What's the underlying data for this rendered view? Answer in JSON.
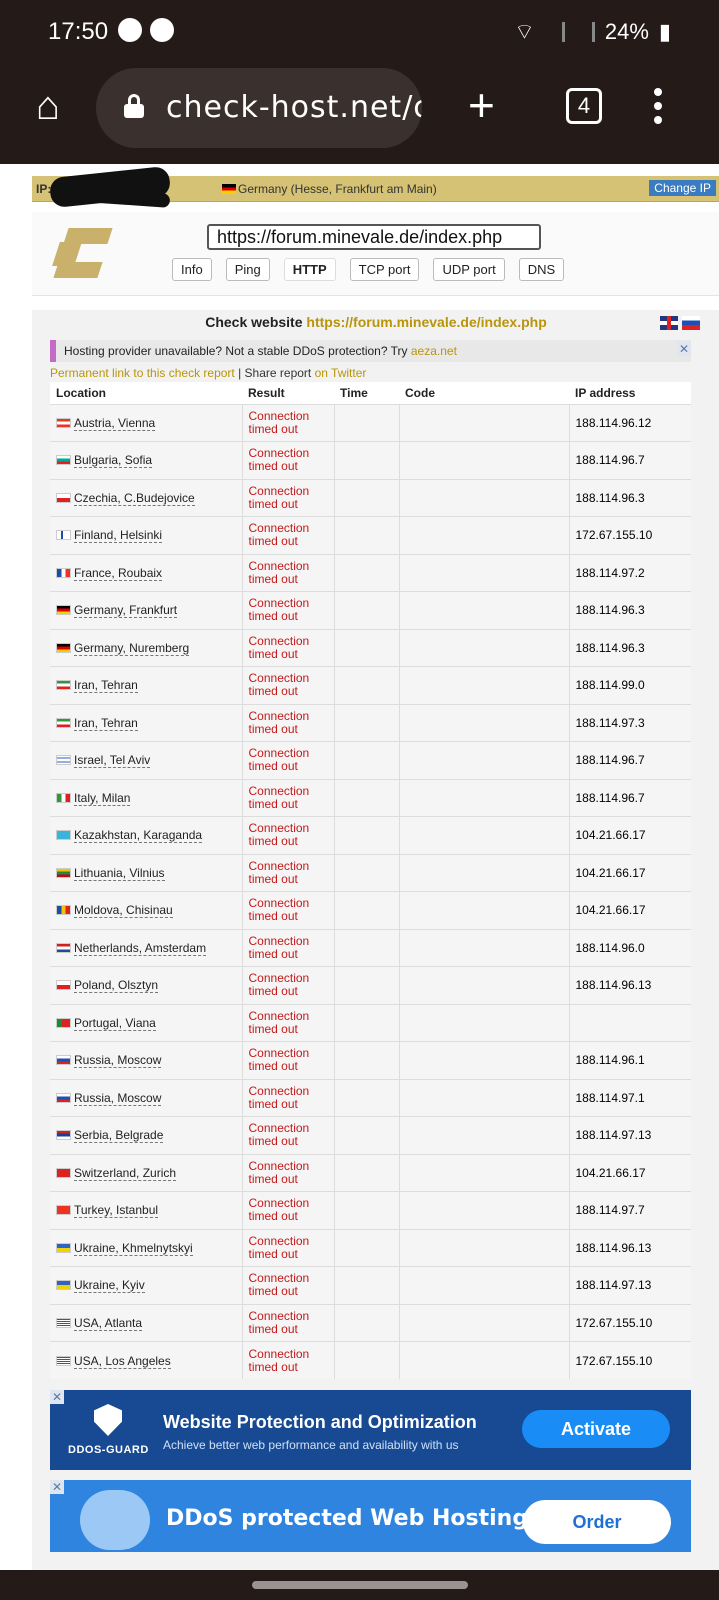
{
  "status": {
    "time": "17:50",
    "battery": "24%"
  },
  "browser": {
    "url": "check-host.net/ch",
    "tab_count": "4"
  },
  "ipbar": {
    "label": "IP:",
    "location": "Germany (Hesse, Frankfurt am Main)",
    "change_ip": "Change IP"
  },
  "search": {
    "url_value": "https://forum.minevale.de/index.php",
    "tabs": [
      "Info",
      "Ping",
      "HTTP",
      "TCP port",
      "UDP port",
      "DNS"
    ],
    "active_tab": "HTTP"
  },
  "check": {
    "title_prefix": "Check website",
    "title_url": "https://forum.minevale.de/index.php",
    "ad_text": "Hosting provider unavailable? Not a stable DDoS protection? Try",
    "ad_link": "aeza.net",
    "permalink": "Permanent link to this check report",
    "separator": " | Share report ",
    "twitter": "on Twitter",
    "headers": [
      "Location",
      "Result",
      "Time",
      "Code",
      "IP address"
    ],
    "error_line1": "Connection",
    "error_line2": "timed out",
    "rows": [
      {
        "location": "Austria, Vienna",
        "ip": "188.114.96.12",
        "flag": "at"
      },
      {
        "location": "Bulgaria, Sofia",
        "ip": "188.114.96.7",
        "flag": "bg"
      },
      {
        "location": "Czechia, C.Budejovice",
        "ip": "188.114.96.3",
        "flag": "cz"
      },
      {
        "location": "Finland, Helsinki",
        "ip": "172.67.155.10",
        "flag": "fi"
      },
      {
        "location": "France, Roubaix",
        "ip": "188.114.97.2",
        "flag": "fr"
      },
      {
        "location": "Germany, Frankfurt",
        "ip": "188.114.96.3",
        "flag": "de"
      },
      {
        "location": "Germany, Nuremberg",
        "ip": "188.114.96.3",
        "flag": "de"
      },
      {
        "location": "Iran, Tehran",
        "ip": "188.114.99.0",
        "flag": "ir"
      },
      {
        "location": "Iran, Tehran",
        "ip": "188.114.97.3",
        "flag": "ir"
      },
      {
        "location": "Israel, Tel Aviv",
        "ip": "188.114.96.7",
        "flag": "il"
      },
      {
        "location": "Italy, Milan",
        "ip": "188.114.96.7",
        "flag": "it"
      },
      {
        "location": "Kazakhstan, Karaganda",
        "ip": "104.21.66.17",
        "flag": "kz"
      },
      {
        "location": "Lithuania, Vilnius",
        "ip": "104.21.66.17",
        "flag": "lt"
      },
      {
        "location": "Moldova, Chisinau",
        "ip": "104.21.66.17",
        "flag": "md"
      },
      {
        "location": "Netherlands, Amsterdam",
        "ip": "188.114.96.0",
        "flag": "nl"
      },
      {
        "location": "Poland, Olsztyn",
        "ip": "188.114.96.13",
        "flag": "pl"
      },
      {
        "location": "Portugal, Viana",
        "ip": "",
        "flag": "pt"
      },
      {
        "location": "Russia, Moscow",
        "ip": "188.114.96.1",
        "flag": "ru"
      },
      {
        "location": "Russia, Moscow",
        "ip": "188.114.97.1",
        "flag": "ru"
      },
      {
        "location": "Serbia, Belgrade",
        "ip": "188.114.97.13",
        "flag": "rs"
      },
      {
        "location": "Switzerland, Zurich",
        "ip": "104.21.66.17",
        "flag": "ch"
      },
      {
        "location": "Turkey, Istanbul",
        "ip": "188.114.97.7",
        "flag": "tr"
      },
      {
        "location": "Ukraine, Khmelnytskyi",
        "ip": "188.114.96.13",
        "flag": "ua"
      },
      {
        "location": "Ukraine, Kyiv",
        "ip": "188.114.97.13",
        "flag": "ua"
      },
      {
        "location": "USA, Atlanta",
        "ip": "172.67.155.10",
        "flag": "us"
      },
      {
        "location": "USA, Los Angeles",
        "ip": "172.67.155.10",
        "flag": "us"
      }
    ]
  },
  "ads": {
    "banner1": {
      "brand": "DDOS-GUARD",
      "title": "Website Protection and Optimization",
      "subtitle": "Achieve better web performance and availability with us",
      "cta": "Activate"
    },
    "banner2": {
      "title": "DDoS protected Web Hosting",
      "cta": "Order"
    }
  },
  "flag_colors": {
    "at": "linear-gradient(#e32 33%, #fff 33% 66%, #e32 66%)",
    "bg": "linear-gradient(#fff 33%, #0a9 33% 66%, #d22 66%)",
    "cz": "linear-gradient(#fff 50%, #d22 50%)",
    "fi": "linear-gradient(90deg, #fff 30%, #1a4fa8 30% 45%, #fff 45%)",
    "fr": "linear-gradient(90deg, #1a4fa8 33%, #fff 33% 66%, #e32 66%)",
    "de": "linear-gradient(#000 33%, #d00 33% 66%, #fc0 66%)",
    "ir": "linear-gradient(#2a9a3a 33%, #fff 33% 66%, #d22 66%)",
    "il": "linear-gradient(#fff 20%, #2b5fc7 20% 30%, #fff 30% 70%, #2b5fc7 70% 80%, #fff 80%)",
    "it": "linear-gradient(90deg, #2a9a3a 33%, #fff 33% 66%, #d22 66%)",
    "kz": "linear-gradient(#3ab4d8, #3ab4d8)",
    "lt": "linear-gradient(#f5c400 33%, #1f8a3a 33% 66%, #c02 66%)",
    "md": "linear-gradient(90deg, #1a4fa8 33%, #f5c400 33% 66%, #d22 66%)",
    "nl": "linear-gradient(#c22 33%, #fff 33% 66%, #1f4aa0 66%)",
    "pl": "linear-gradient(#fff 50%, #d22 50%)",
    "pt": "linear-gradient(90deg, #1f8a3a 40%, #d22 40%)",
    "ru": "linear-gradient(#fff 33%, #1c4fb8 33% 66%, #d22 66%)",
    "rs": "linear-gradient(#c22 33%, #1c3f94 33% 66%, #fff 66%)",
    "ch": "linear-gradient(#d22, #d22)",
    "tr": "linear-gradient(#e32, #e32)",
    "ua": "linear-gradient(#2b66c7 50%, #f5d000 50%)",
    "us": "repeating-linear-gradient(#c22 0 1px, #fff 1px 2px)"
  }
}
